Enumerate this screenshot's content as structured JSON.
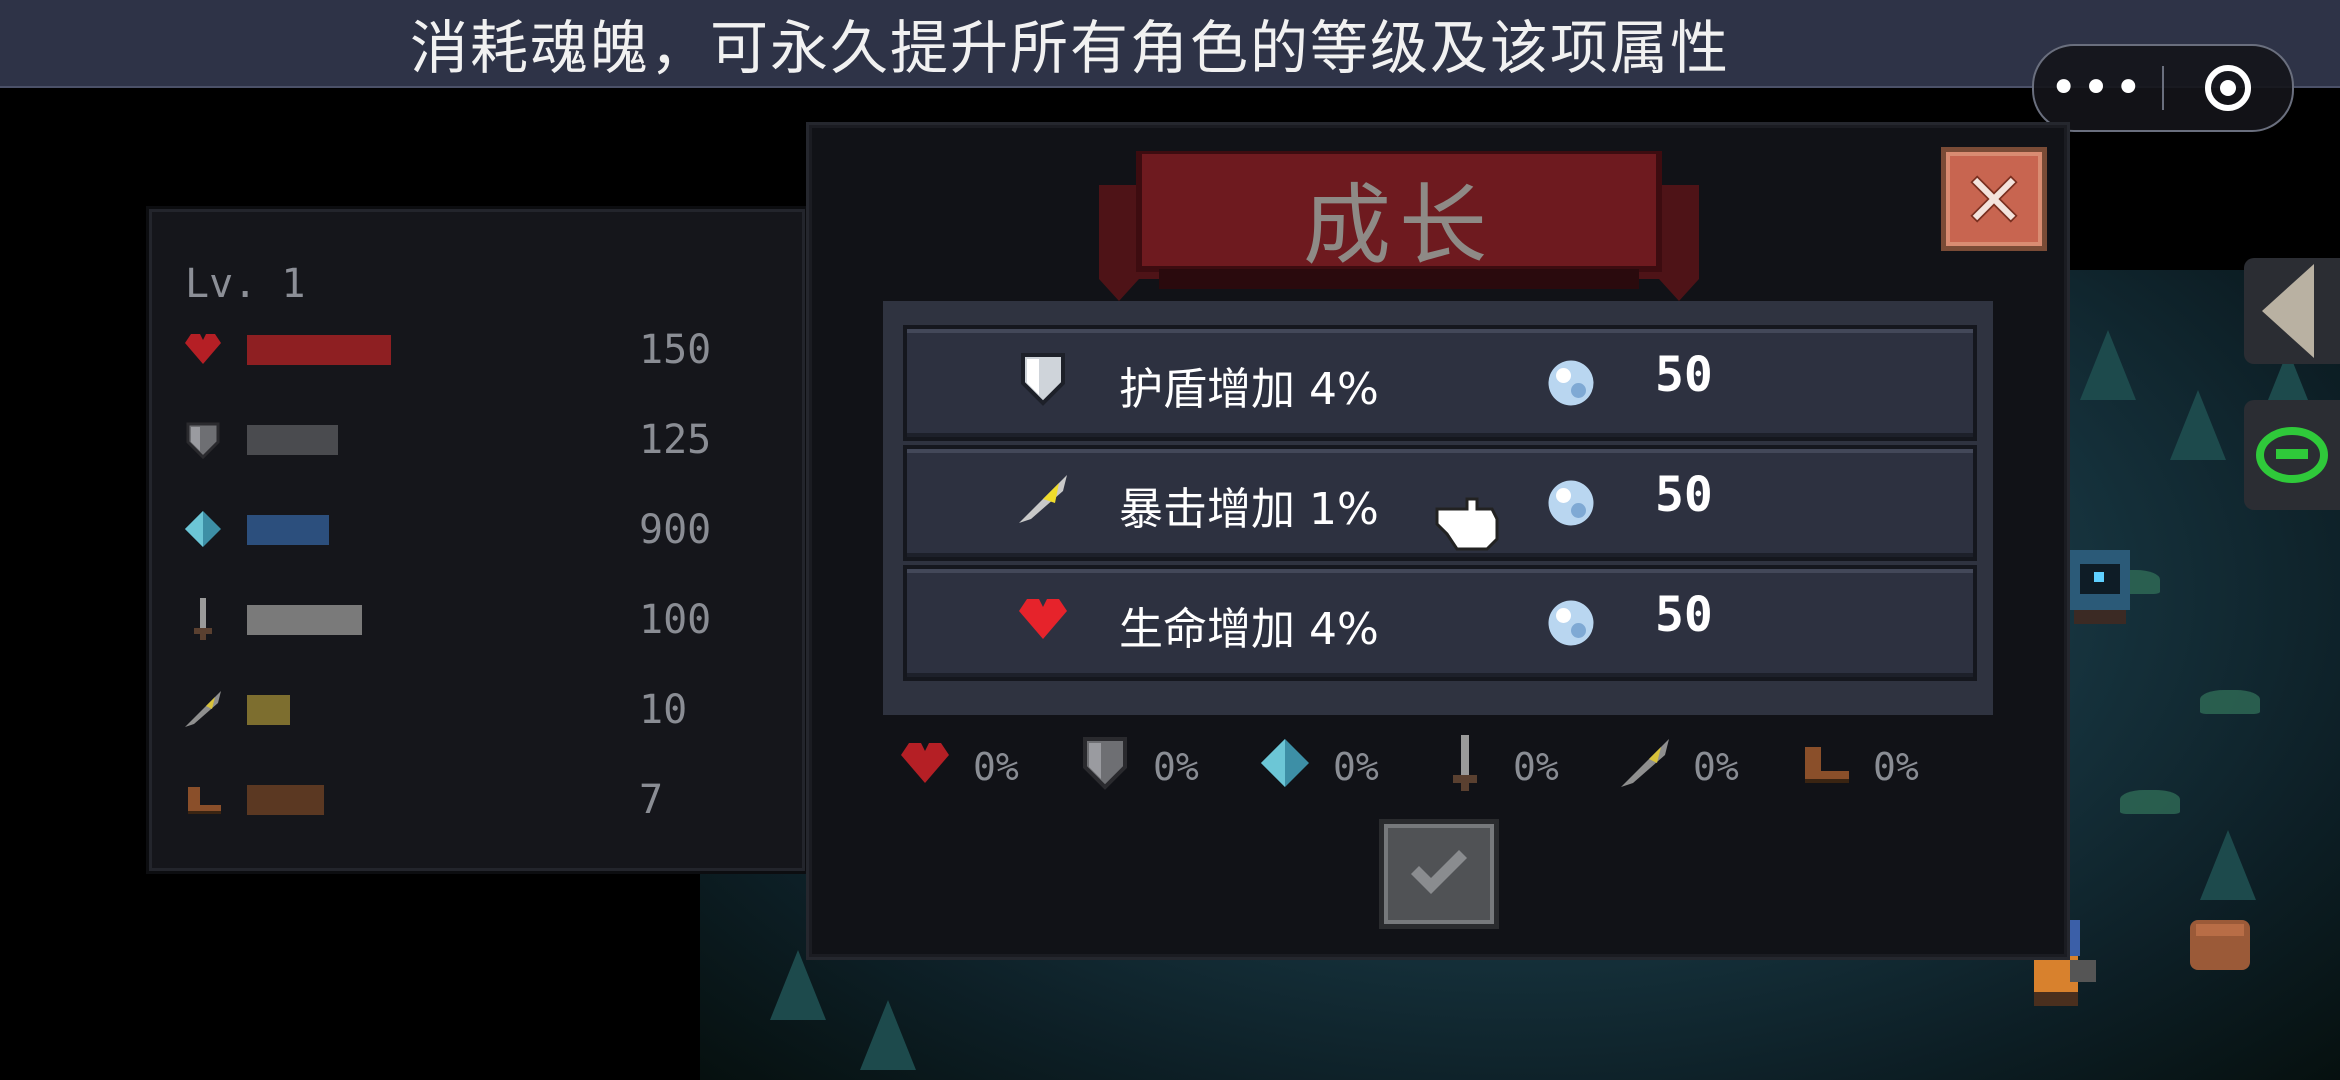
{
  "banner": {
    "text": "消耗魂魄，可永久提升所有角色的等级及该项属性"
  },
  "capsule": {
    "more_label": "•••",
    "more_icon": "more-dots-icon",
    "close_icon": "target-circle-icon"
  },
  "stats": {
    "level": "Lv. 1",
    "rows": [
      {
        "icon": "heart-icon",
        "value": "150",
        "bar_color": "#8e1f22",
        "bar_fill": 0.6
      },
      {
        "icon": "shield-icon",
        "value": "125",
        "bar_color": "#4a4b4f",
        "bar_fill": 0.38
      },
      {
        "icon": "diamond-icon",
        "value": "900",
        "bar_color": "#2c4f7d",
        "bar_fill": 0.34
      },
      {
        "icon": "sword-icon",
        "value": "100",
        "bar_color": "#7a7a7a",
        "bar_fill": 0.48
      },
      {
        "icon": "crit-feather-icon",
        "value": "10",
        "bar_color": "#7d6e2f",
        "bar_fill": 0.18
      },
      {
        "icon": "boot-icon",
        "value": "7",
        "bar_color": "#5b3822",
        "bar_fill": 0.32
      }
    ]
  },
  "dialog": {
    "title": "成长",
    "options": [
      {
        "icon": "shield-icon",
        "label": "护盾增加 4%",
        "cost_icon": "soul-gem-icon",
        "cost": "50"
      },
      {
        "icon": "crit-feather-icon",
        "label": "暴击增加 1%",
        "cost_icon": "soul-gem-icon",
        "cost": "50"
      },
      {
        "icon": "heart-icon",
        "label": "生命增加 4%",
        "cost_icon": "soul-gem-icon",
        "cost": "50"
      }
    ],
    "bonuses": [
      {
        "icon": "heart-icon",
        "value": "0%"
      },
      {
        "icon": "shield-icon",
        "value": "0%"
      },
      {
        "icon": "diamond-icon",
        "value": "0%"
      },
      {
        "icon": "sword-icon",
        "value": "0%"
      },
      {
        "icon": "crit-feather-icon",
        "value": "0%"
      },
      {
        "icon": "boot-icon",
        "value": "0%"
      }
    ]
  },
  "colors": {
    "banner_bg": "#2e3347",
    "close_button": "#c86550",
    "ribbon": "#6e1a1f",
    "eye_green": "#2fc93a"
  }
}
